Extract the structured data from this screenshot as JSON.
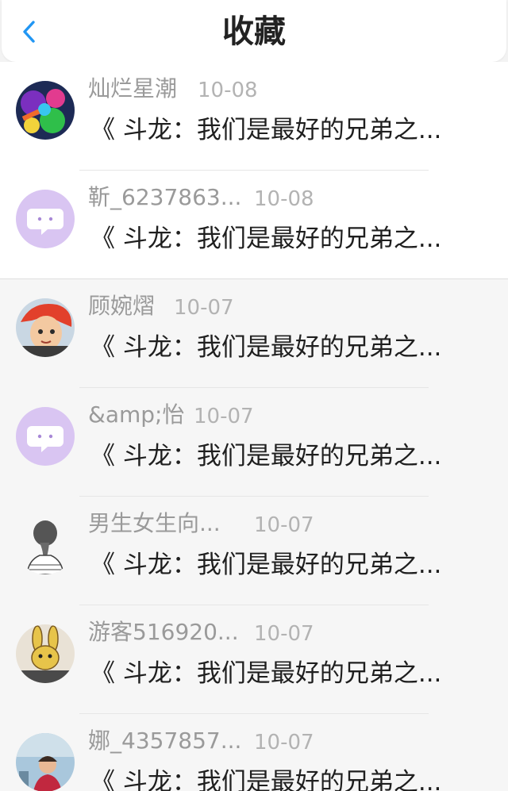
{
  "header": {
    "title": "收藏",
    "back_icon": "chevron-left-icon",
    "accent_color": "#2196f3"
  },
  "items": [
    {
      "user": "灿烂星潮",
      "date": "10-08",
      "title": "《 斗龙：我们是最好的兄弟之...",
      "avatar": "colorful-game-avatar"
    },
    {
      "user": "靳_6237863...",
      "date": "10-08",
      "title": "《 斗龙：我们是最好的兄弟之...",
      "avatar": "default-chat-avatar"
    },
    {
      "user": "顾婉熠",
      "date": "10-07",
      "title": "《 斗龙：我们是最好的兄弟之...",
      "avatar": "cartoon-character-avatar"
    },
    {
      "user": "&amp;怡",
      "date": "10-07",
      "title": "《 斗龙：我们是最好的兄弟之...",
      "avatar": "default-chat-avatar"
    },
    {
      "user": "男生女生向...",
      "date": "10-07",
      "title": "《 斗龙：我们是最好的兄弟之...",
      "avatar": "sketch-girl-avatar"
    },
    {
      "user": "游客516920...",
      "date": "10-07",
      "title": "《 斗龙：我们是最好的兄弟之...",
      "avatar": "cartoon-rabbit-avatar"
    },
    {
      "user": "娜_4357857...",
      "date": "10-07",
      "title": "《 斗龙：我们是最好的兄弟之...",
      "avatar": "photo-child-avatar"
    }
  ]
}
